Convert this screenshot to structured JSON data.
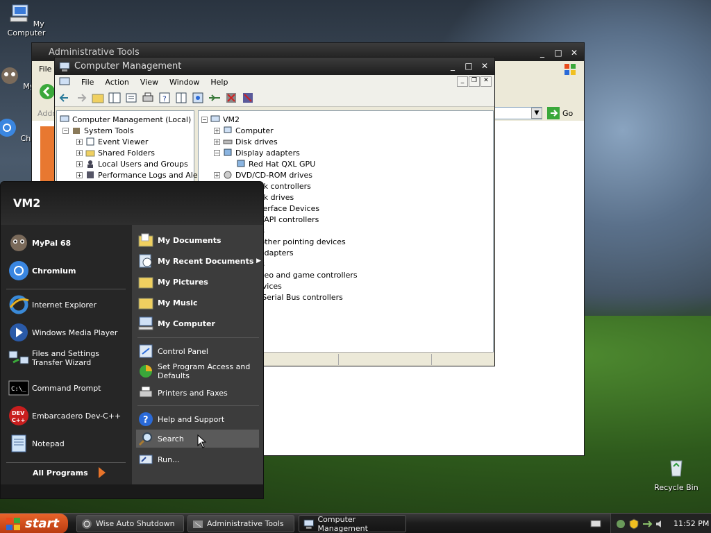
{
  "desktop": {
    "icons": [
      {
        "label": "My Computer",
        "icon": "my-computer-icon"
      },
      {
        "label": "MyPa",
        "icon": "mypal-icon"
      },
      {
        "label": "Chrom",
        "icon": "chromium-icon"
      },
      {
        "label": "Recycle Bin",
        "icon": "recycle-bin-icon"
      }
    ]
  },
  "admin_tools": {
    "title": "Administrative Tools",
    "menu_first": "File",
    "address_label": "Addr",
    "go_label": "Go"
  },
  "comp_mgmt": {
    "title": "Computer Management",
    "menu": [
      "File",
      "Action",
      "View",
      "Window",
      "Help"
    ],
    "left_tree": [
      {
        "label": "Computer Management (Local)",
        "level": 0
      },
      {
        "label": "System Tools",
        "level": 1,
        "expander": "−"
      },
      {
        "label": "Event Viewer",
        "level": 2,
        "expander": "+"
      },
      {
        "label": "Shared Folders",
        "level": 2,
        "expander": "+"
      },
      {
        "label": "Local Users and Groups",
        "level": 2,
        "expander": "+"
      },
      {
        "label": "Performance Logs and Alerts",
        "level": 2,
        "expander": "+"
      }
    ],
    "device_tree": [
      {
        "label": "VM2",
        "level": 0,
        "expander": "−"
      },
      {
        "label": "Computer",
        "level": 1,
        "expander": "+"
      },
      {
        "label": "Disk drives",
        "level": 1,
        "expander": "+"
      },
      {
        "label": "Display adapters",
        "level": 1,
        "expander": "−"
      },
      {
        "label": "Red Hat QXL GPU",
        "level": 2
      },
      {
        "label": "DVD/CD-ROM drives",
        "level": 1,
        "expander": "+"
      },
      {
        "label": "disk controllers",
        "level": 1
      },
      {
        "label": "disk drives",
        "level": 1
      },
      {
        "label": "Interface Devices",
        "level": 1
      },
      {
        "label": "/ATAPI controllers",
        "level": 1
      },
      {
        "label": "rds",
        "level": 1
      },
      {
        "label": "d other pointing devices",
        "level": 1
      },
      {
        "label": "k adapters",
        "level": 1
      },
      {
        "label": "ors",
        "level": 1
      },
      {
        "label": "video and game controllers",
        "level": 1
      },
      {
        "label": "devices",
        "level": 1
      },
      {
        "label": "al Serial Bus controllers",
        "level": 1
      }
    ]
  },
  "start_menu": {
    "user": "VM2",
    "pinned": [
      {
        "label": "MyPal 68",
        "icon": "mypal-icon"
      },
      {
        "label": "Chromium",
        "icon": "chromium-icon"
      }
    ],
    "recent": [
      {
        "label": "Internet Explorer",
        "icon": "internet-explorer-icon"
      },
      {
        "label": "Windows Media Player",
        "icon": "media-player-icon"
      },
      {
        "label": "Files and Settings Transfer Wizard",
        "icon": "transfer-wizard-icon"
      },
      {
        "label": "Command Prompt",
        "icon": "command-prompt-icon"
      },
      {
        "label": "Embarcadero Dev-C++",
        "icon": "devcpp-icon"
      },
      {
        "label": "Notepad",
        "icon": "notepad-icon"
      }
    ],
    "all_programs": "All Programs",
    "right_bold": [
      {
        "label": "My Documents",
        "icon": "folder-icon"
      },
      {
        "label": "My Recent Documents",
        "icon": "recent-documents-icon"
      },
      {
        "label": "My Pictures",
        "icon": "folder-icon"
      },
      {
        "label": "My Music",
        "icon": "folder-icon"
      },
      {
        "label": "My Computer",
        "icon": "my-computer-icon"
      }
    ],
    "right_items": [
      {
        "label": "Control Panel",
        "icon": "control-panel-icon"
      },
      {
        "label": "Set Program Access and Defaults",
        "icon": "program-defaults-icon"
      },
      {
        "label": "Printers and Faxes",
        "icon": "printer-icon"
      },
      {
        "label": "Help and Support",
        "icon": "help-icon"
      },
      {
        "label": "Search",
        "icon": "search-icon"
      },
      {
        "label": "Run...",
        "icon": "run-icon"
      }
    ]
  },
  "taskbar": {
    "start_label": "start",
    "tasks": [
      {
        "label": "Wise Auto Shutdown"
      },
      {
        "label": "Administrative Tools"
      },
      {
        "label": "Computer Management"
      }
    ],
    "clock": "11:52 PM"
  },
  "colors": {
    "start_button": "#d4501c",
    "window_title": "#2a2a2a",
    "menu_highlight": "#5a5a5a"
  }
}
